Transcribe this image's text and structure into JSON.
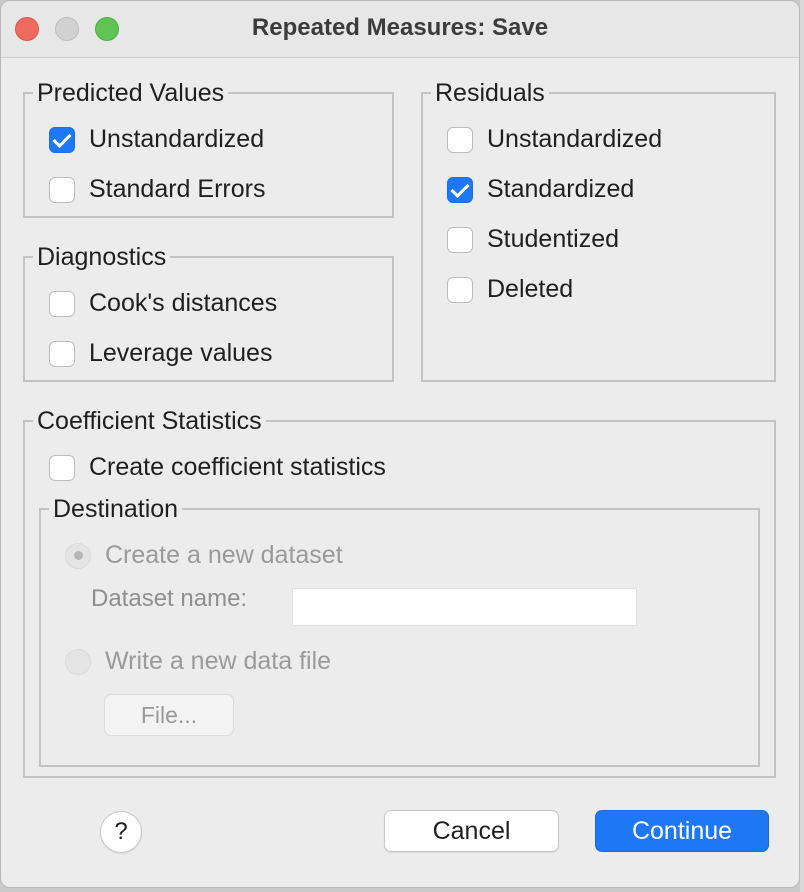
{
  "window": {
    "title": "Repeated Measures: Save"
  },
  "predicted_values": {
    "legend": "Predicted Values",
    "options": [
      {
        "label": "Unstandardized",
        "checked": true
      },
      {
        "label": "Standard Errors",
        "checked": false
      }
    ]
  },
  "diagnostics": {
    "legend": "Diagnostics",
    "options": [
      {
        "label": "Cook's distances",
        "checked": false
      },
      {
        "label": "Leverage values",
        "checked": false
      }
    ]
  },
  "residuals": {
    "legend": "Residuals",
    "options": [
      {
        "label": "Unstandardized",
        "checked": false
      },
      {
        "label": "Standardized",
        "checked": true
      },
      {
        "label": "Studentized",
        "checked": false
      },
      {
        "label": "Deleted",
        "checked": false
      }
    ]
  },
  "coefficient_statistics": {
    "legend": "Coefficient Statistics",
    "create_label": "Create coefficient statistics",
    "create_checked": false,
    "destination": {
      "legend": "Destination",
      "new_dataset_label": "Create a new dataset",
      "new_dataset_selected": true,
      "dataset_name_label": "Dataset name:",
      "dataset_name_value": "",
      "new_file_label": "Write a new data file",
      "new_file_selected": false,
      "file_button_label": "File..."
    }
  },
  "footer": {
    "help_label": "?",
    "cancel_label": "Cancel",
    "continue_label": "Continue"
  },
  "colors": {
    "accent": "#1e78f5",
    "window_bg": "#ececec",
    "close": "#ee6a5e",
    "zoom": "#5fc454"
  }
}
